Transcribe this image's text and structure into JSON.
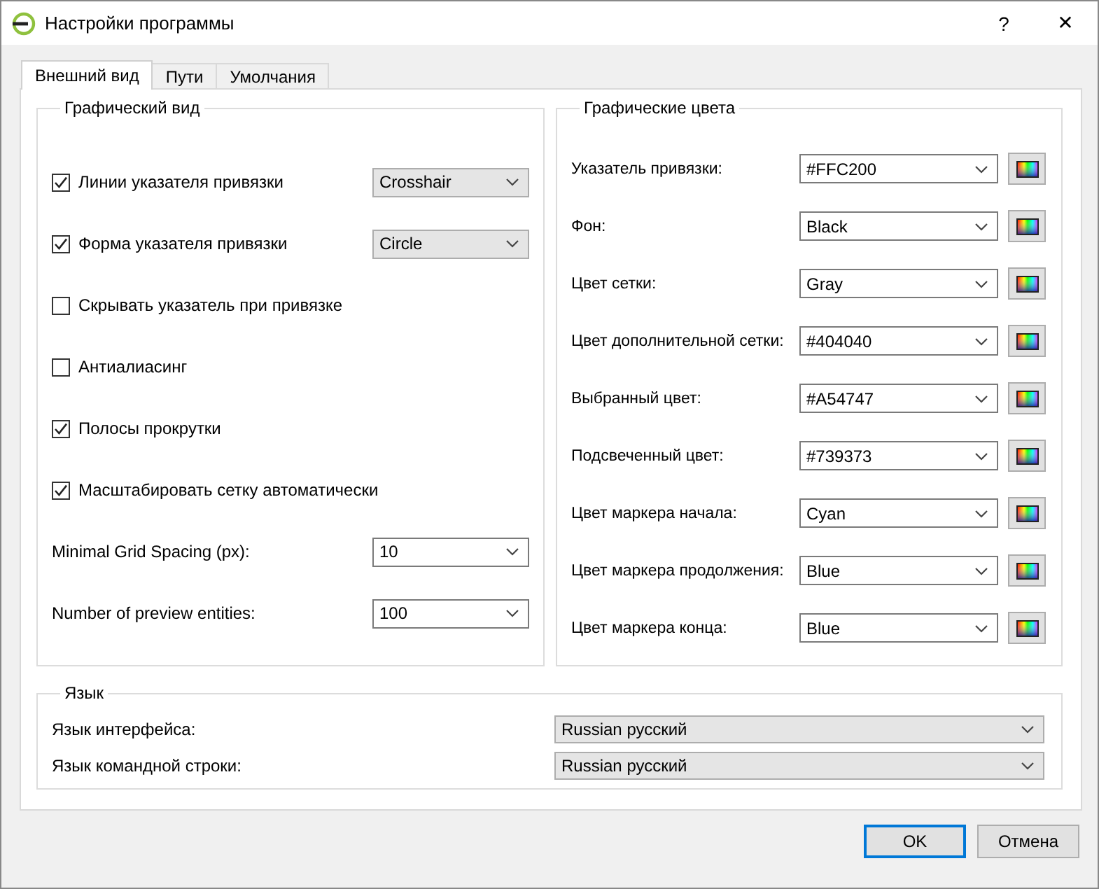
{
  "window": {
    "title": "Настройки программы",
    "help": "?",
    "close": "✕"
  },
  "tabs": [
    {
      "label": "Внешний вид",
      "selected": true
    },
    {
      "label": "Пути",
      "selected": false
    },
    {
      "label": "Умолчания",
      "selected": false
    }
  ],
  "graphic_view": {
    "title": "Графический вид",
    "items": [
      {
        "kind": "checkbox",
        "label": "Линии указателя привязки",
        "checked": true,
        "combo": {
          "value": "Crosshair",
          "editable": false
        }
      },
      {
        "kind": "checkbox",
        "label": "Форма указателя привязки",
        "checked": true,
        "combo": {
          "value": "Circle",
          "editable": false
        }
      },
      {
        "kind": "checkbox",
        "label": "Скрывать указатель при привязке",
        "checked": false
      },
      {
        "kind": "checkbox",
        "label": "Антиалиасинг",
        "checked": false
      },
      {
        "kind": "checkbox",
        "label": "Полосы прокрутки",
        "checked": true
      },
      {
        "kind": "checkbox",
        "label": "Масштабировать сетку автоматически",
        "checked": true
      },
      {
        "kind": "combo",
        "label": "Minimal Grid Spacing (px):",
        "combo": {
          "value": "10",
          "editable": true
        }
      },
      {
        "kind": "combo",
        "label": "Number of preview entities:",
        "combo": {
          "value": "100",
          "editable": true
        }
      }
    ]
  },
  "graphic_colors": {
    "title": "Графические цвета",
    "items": [
      {
        "label": "Указатель привязки:",
        "value": "#FFC200"
      },
      {
        "label": "Фон:",
        "value": "Black"
      },
      {
        "label": "Цвет сетки:",
        "value": "Gray"
      },
      {
        "label": "Цвет дополнительной сетки:",
        "value": "#404040"
      },
      {
        "label": "Выбранный цвет:",
        "value": "#A54747"
      },
      {
        "label": "Подсвеченный цвет:",
        "value": "#739373"
      },
      {
        "label": "Цвет маркера начала:",
        "value": "Cyan"
      },
      {
        "label": "Цвет маркера продолжения:",
        "value": "Blue"
      },
      {
        "label": "Цвет маркера конца:",
        "value": "Blue"
      }
    ]
  },
  "language": {
    "title": "Язык",
    "items": [
      {
        "label": "Язык интерфейса:",
        "value": "Russian русский"
      },
      {
        "label": "Язык командной строки:",
        "value": "Russian русский"
      }
    ]
  },
  "buttons": [
    {
      "label": "OK",
      "default": true
    },
    {
      "label": "Отмена",
      "default": false
    }
  ]
}
